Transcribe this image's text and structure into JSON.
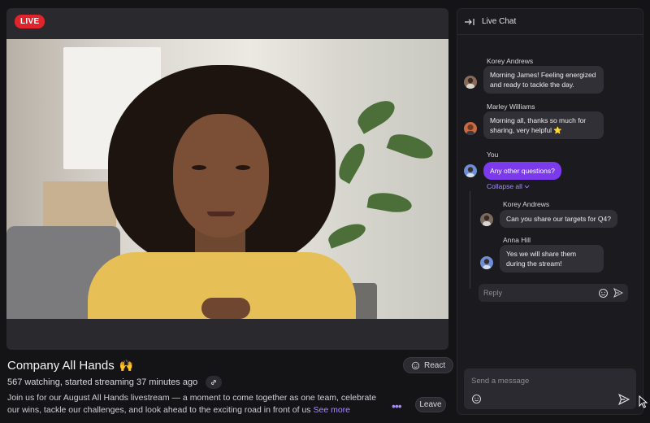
{
  "stage": {
    "live_label": "LIVE"
  },
  "stream": {
    "title": "Company All Hands",
    "title_emoji": "🙌",
    "react_label": "React",
    "meta": "567 watching, started streaming 37 minutes ago",
    "description": "Join us for our August All Hands livestream — a moment to come together as one team, celebrate our wins, tackle our challenges, and look ahead to the exciting road in front of us",
    "see_more": "See more",
    "leave_label": "Leave"
  },
  "chat": {
    "header": "Live Chat",
    "messages": [
      {
        "sender": "Korey Andrews",
        "text": "Morning James! Feeling energized and ready to tackle the day."
      },
      {
        "sender": "Marley Williams",
        "text": "Morning all, thanks so much for sharing, very helpful ⭐"
      },
      {
        "sender": "You",
        "text": "Any other questions?"
      }
    ],
    "collapse_label": "Collapse all",
    "thread": [
      {
        "sender": "Korey Andrews",
        "text": "Can you share our targets for Q4?"
      },
      {
        "sender": "Anna Hill",
        "text": "Yes we will share them during the stream!"
      }
    ],
    "reply_placeholder": "Reply",
    "send_placeholder": "Send a message"
  },
  "colors": {
    "accent": "#7c3aed",
    "live": "#e0242c",
    "link": "#a78bfa"
  }
}
